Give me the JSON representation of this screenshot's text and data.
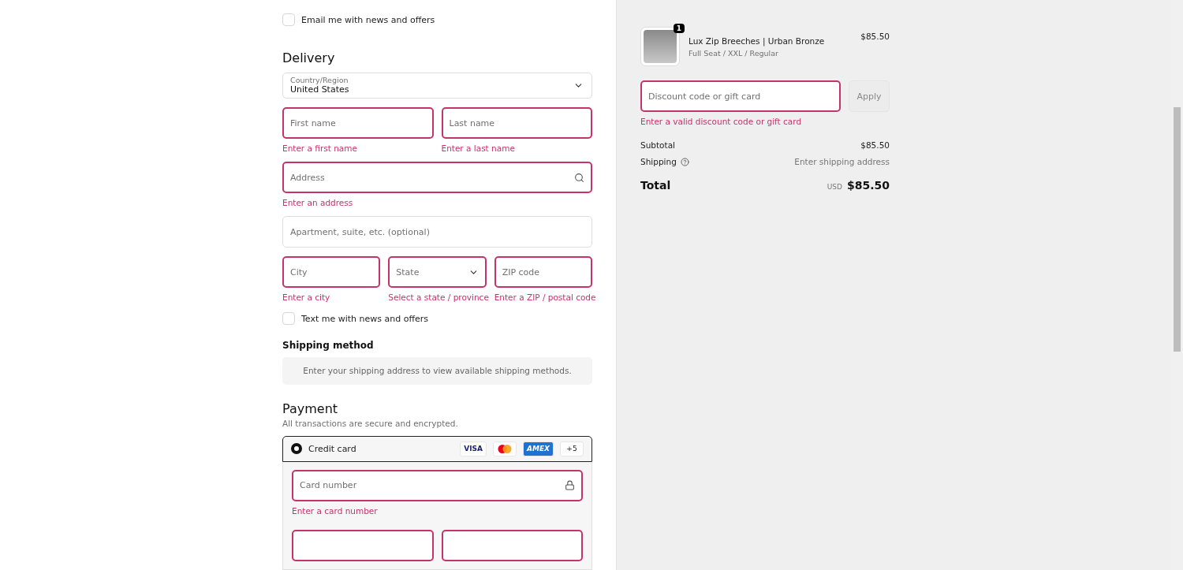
{
  "email_offers": {
    "label": "Email me with news and offers",
    "checked": false
  },
  "delivery": {
    "title": "Delivery",
    "country": {
      "label": "Country/Region",
      "value": "United States"
    },
    "rows": [
      [
        {
          "kind": "input",
          "placeholder": "First name",
          "error": "Enter a first name"
        },
        {
          "kind": "input",
          "placeholder": "Last name",
          "error": "Enter a last name"
        }
      ],
      [
        {
          "kind": "search",
          "placeholder": "Address",
          "error": "Enter an address"
        }
      ],
      [
        {
          "kind": "input",
          "placeholder": "Apartment, suite, etc. (optional)"
        }
      ],
      [
        {
          "kind": "input",
          "placeholder": "City",
          "error": "Enter a city"
        },
        {
          "kind": "select",
          "placeholder": "State",
          "error": "Select a state / province"
        },
        {
          "kind": "input",
          "placeholder": "ZIP code",
          "error": "Enter a ZIP / postal code"
        }
      ]
    ]
  },
  "sms_offers": {
    "label": "Text me with news and offers",
    "checked": false
  },
  "shipping_method": {
    "title": "Shipping method",
    "message": "Enter your shipping address to view available shipping methods."
  },
  "payment": {
    "title": "Payment",
    "subtitle": "All transactions are secure and encrypted.",
    "method": {
      "label": "Credit card",
      "selected": true,
      "cards": [
        {
          "kind": "visa",
          "label": "VISA"
        },
        {
          "kind": "mastercard"
        },
        {
          "kind": "amex",
          "label": "AMEX"
        },
        {
          "kind": "more",
          "label": "+5"
        }
      ]
    },
    "card_number": {
      "placeholder": "Card number",
      "error": "Enter a card number"
    }
  },
  "summary": {
    "item": {
      "name": "Lux Zip Breeches | Urban Bronze",
      "variant": "Full Seat / XXL / Regular",
      "price": "$85.50",
      "quantity": "1"
    },
    "discount": {
      "placeholder": "Discount code or gift card",
      "error": "Enter a valid discount code or gift card",
      "button": "Apply",
      "button_disabled": true
    },
    "lines": [
      {
        "label": "Subtotal",
        "value": "$85.50",
        "info": false,
        "muted": false
      },
      {
        "label": "Shipping",
        "value": "Enter shipping address",
        "info": true,
        "muted": true
      }
    ],
    "total": {
      "label": "Total",
      "currency": "USD",
      "value": "$85.50"
    }
  }
}
